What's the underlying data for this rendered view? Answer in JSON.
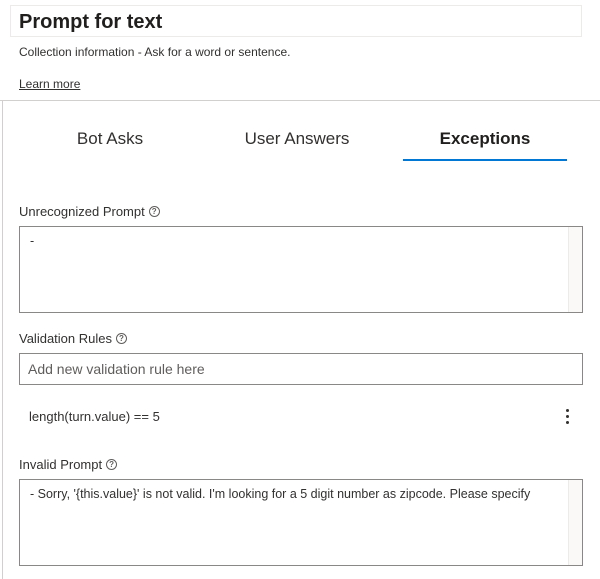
{
  "header": {
    "title": "Prompt for text",
    "subtitle": "Collection information - Ask for a word or sentence.",
    "learn_more": "Learn more"
  },
  "tabs": [
    {
      "label": "Bot Asks",
      "active": false
    },
    {
      "label": "User Answers",
      "active": false
    },
    {
      "label": "Exceptions",
      "active": true
    }
  ],
  "accent_color": "#0078d4",
  "unrecognized_prompt": {
    "label": "Unrecognized Prompt",
    "value": "-"
  },
  "validation_rules": {
    "label": "Validation Rules",
    "placeholder": "Add new validation rule here",
    "rules": [
      "length(turn.value) == 5"
    ]
  },
  "invalid_prompt": {
    "label": "Invalid Prompt",
    "value": "- Sorry, '{this.value}' is not valid. I'm looking for a 5 digit number as zipcode. Please specify"
  },
  "icons": {
    "help": "question-circle-icon",
    "more": "more-vertical-icon"
  }
}
